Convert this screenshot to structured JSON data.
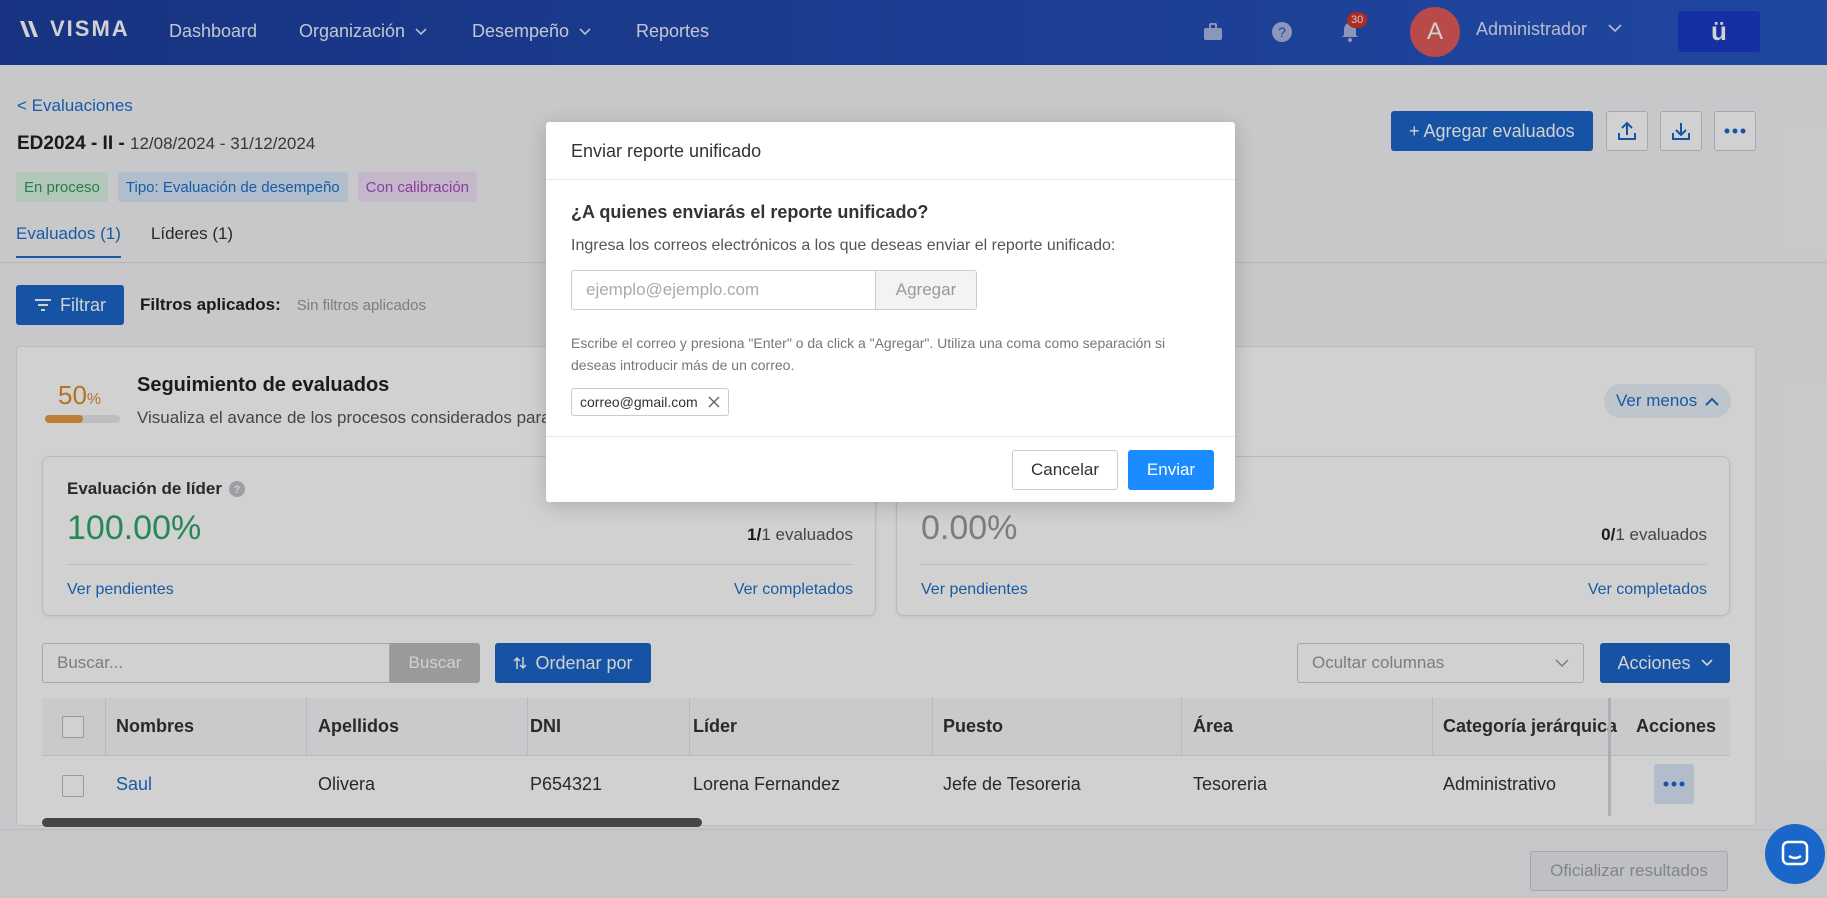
{
  "nav": {
    "logo": "VISMA",
    "items": [
      {
        "label": "Dashboard",
        "has_dropdown": false
      },
      {
        "label": "Organización",
        "has_dropdown": true
      },
      {
        "label": "Desempeño",
        "has_dropdown": true
      },
      {
        "label": "Reportes",
        "has_dropdown": false
      }
    ],
    "notifications_count": "30",
    "avatar_initial": "A",
    "user_name": "Administrador",
    "brand_button": "ü"
  },
  "page": {
    "back_link": "< Evaluaciones",
    "title": "ED2024 - II -",
    "dates": "12/08/2024 - 31/12/2024",
    "tags": [
      "En proceso",
      "Tipo: Evaluación de desempeño",
      "Con calibración"
    ],
    "tabs": [
      "Evaluados (1)",
      "Líderes (1)"
    ],
    "add_button": "+ Agregar evaluados",
    "filter_button": "Filtrar",
    "filters_label": "Filtros aplicados:",
    "filters_value": "Sin filtros aplicados"
  },
  "tracking": {
    "percent": "50",
    "percent_unit": "%",
    "progress_fraction": 0.5,
    "title": "Seguimiento de evaluados",
    "subtitle": "Visualiza el avance de los procesos considerados para",
    "toggle": "Ver menos",
    "cards": [
      {
        "title": "Evaluación de líder",
        "value": "100.00%",
        "count_done": "1/",
        "count_total": "1 evaluados",
        "link_pending": "Ver pendientes",
        "link_done": "Ver completados",
        "value_color": "#2fa66a"
      },
      {
        "title": "",
        "value": "0.00%",
        "count_done": "0/",
        "count_total": "1 evaluados",
        "link_pending": "Ver pendientes",
        "link_done": "Ver completados",
        "value_color": "#999999"
      }
    ]
  },
  "toolbar": {
    "search_placeholder": "Buscar...",
    "search_button": "Buscar",
    "order_button": "Ordenar por",
    "hide_columns": "Ocultar columnas",
    "actions_button": "Acciones"
  },
  "table": {
    "headers": [
      "Nombres",
      "Apellidos",
      "DNI",
      "Líder",
      "Puesto",
      "Área",
      "Categoría jerárquica",
      "Acciones"
    ],
    "rows": [
      [
        "Saul",
        "Olivera",
        "P654321",
        "Lorena Fernandez",
        "Jefe de Tesoreria",
        "Tesoreria",
        "Administrativo"
      ]
    ]
  },
  "footer": {
    "officialize_button": "Oficializar resultados"
  },
  "modal": {
    "title": "Enviar reporte unificado",
    "question": "¿A quienes enviarás el reporte unificado?",
    "description": "Ingresa los correos electrónicos a los que deseas enviar el reporte unificado:",
    "email_placeholder": "ejemplo@ejemplo.com",
    "add_button": "Agregar",
    "help": "Escribe el correo y presiona \"Enter\" o da click a \"Agregar\". Utiliza una coma como separación si deseas introducir más de un correo.",
    "chips": [
      "correo@gmail.com"
    ],
    "cancel_button": "Cancelar",
    "send_button": "Enviar"
  }
}
